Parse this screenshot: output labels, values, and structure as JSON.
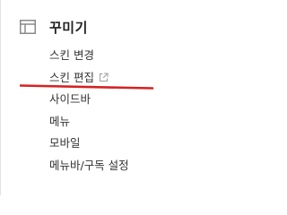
{
  "section": {
    "title": "꾸미기",
    "icon": "layout-icon"
  },
  "menu": {
    "items": [
      {
        "label": "스킨 변경"
      },
      {
        "label": "스킨 편집",
        "icon": "external-link-icon"
      },
      {
        "label": "사이드바"
      },
      {
        "label": "메뉴"
      },
      {
        "label": "모바일"
      },
      {
        "label": "메뉴바/구독 설정"
      }
    ]
  },
  "annotation": {
    "type": "hand-drawn underline",
    "color": "#d62222",
    "target": "스킨 편집"
  },
  "colors": {
    "text": "#333333",
    "title": "#222222",
    "icon": "#8a8a8a",
    "divider": "#e2e2e2"
  }
}
